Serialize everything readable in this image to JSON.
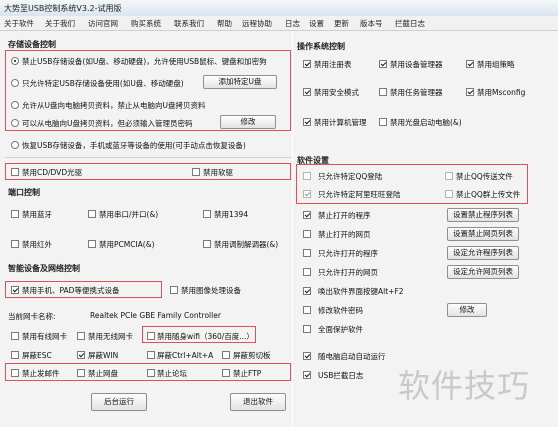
{
  "window": {
    "title": "大势至USB控制系统V3.2-试用版"
  },
  "menu": [
    "关于软件",
    "关于我们",
    "访问官网",
    "购买系统",
    "联系我们",
    "帮助",
    "远程协助",
    "日志",
    "设置",
    "更新",
    "版本号",
    "拦截日志"
  ],
  "storage": {
    "title": "存储设备控制",
    "options": [
      {
        "label": "禁止USB存储设备(如U盘、移动硬盘)，允许使用USB鼠标、键盘和加密狗",
        "selected": true
      },
      {
        "label": "只允许特定USB存储设备使用(如U盘、移动硬盘)",
        "selected": false
      },
      {
        "label": "允许从U盘向电脑拷贝资料，禁止从电脑向U盘拷贝资料",
        "selected": false
      },
      {
        "label": "可以从电脑向U盘拷贝资料，但必须输入管理员密码",
        "selected": false
      },
      {
        "label": "恢复USB存储设备，手机或蓝牙等设备的使用(可手动点击恢复设备)",
        "selected": false
      }
    ],
    "add_button": "添加特定U盘",
    "modify_button": "修改"
  },
  "media": {
    "cdrom": "禁用CD/DVD光驱",
    "floppy": "禁用软驱"
  },
  "ports": {
    "title": "端口控制",
    "items": [
      "禁用蓝牙",
      "禁用串口/并口(&)",
      "禁用1394",
      "禁用红外",
      "禁用PCMCIA(&)",
      "禁用调制解调器(&)"
    ]
  },
  "smart": {
    "title": "智能设备及网络控制",
    "phone": "禁用手机、PAD等便携式设备",
    "image": "禁用图像处理设备"
  },
  "nic": {
    "label": "当前网卡名称:",
    "value": "Realtek PCIe GBE Family Controller"
  },
  "net_items": [
    {
      "label": "禁用有线网卡",
      "checked": false
    },
    {
      "label": "禁用无线网卡",
      "checked": false
    },
    {
      "label": "禁用随身wifi（360/百度...）",
      "checked": false
    },
    {
      "label": "屏蔽ESC",
      "checked": false
    },
    {
      "label": "屏蔽WIN",
      "checked": true
    },
    {
      "label": "屏蔽Ctrl+Alt+A",
      "checked": false
    },
    {
      "label": "屏蔽剪切板",
      "checked": false
    },
    {
      "label": "禁止发邮件",
      "checked": false
    },
    {
      "label": "禁止网盘",
      "checked": false
    },
    {
      "label": "禁止论坛",
      "checked": false
    },
    {
      "label": "禁止FTP",
      "checked": false
    }
  ],
  "bottom": {
    "background_run": "后台运行",
    "exit": "退出软件"
  },
  "os": {
    "title": "操作系统控制",
    "items": [
      {
        "label": "禁用注册表",
        "checked": true
      },
      {
        "label": "禁用设备管理器",
        "checked": true
      },
      {
        "label": "禁用组策略",
        "checked": true
      },
      {
        "label": "禁用安全模式",
        "checked": true
      },
      {
        "label": "禁用任务管理器",
        "checked": false
      },
      {
        "label": "禁用Msconfig",
        "checked": true
      },
      {
        "label": "禁用计算机管理",
        "checked": true
      },
      {
        "label": "禁用光盘启动电脑(&)",
        "checked": false
      }
    ]
  },
  "software": {
    "title": "软件设置",
    "qq": [
      {
        "label": "只允许特定QQ登陆",
        "checked": false
      },
      {
        "label": "禁止QQ传送文件",
        "checked": false
      },
      {
        "label": "只允许特定阿里旺旺登陆",
        "checked": true
      },
      {
        "label": "禁止QQ群上传文件",
        "checked": false
      }
    ],
    "rows": [
      {
        "label": "禁止打开的程序",
        "checked": true,
        "button": "设置禁止程序列表"
      },
      {
        "label": "禁止打开的网页",
        "checked": false,
        "button": "设置禁止网页列表"
      },
      {
        "label": "只允许打开的程序",
        "checked": false,
        "button": "设定允许程序列表"
      },
      {
        "label": "只允许打开的网页",
        "checked": false,
        "button": "设定允许网页列表"
      },
      {
        "label": "唤出软件界面按键Alt+F2",
        "checked": true,
        "button": ""
      },
      {
        "label": "修改软件密码",
        "checked": false,
        "button": "修改"
      },
      {
        "label": "全面保护软件",
        "checked": false,
        "button": ""
      },
      {
        "label": "随电脑启动自动运行",
        "checked": true,
        "button": ""
      },
      {
        "label": "USB拦截日志",
        "checked": true,
        "button": ""
      }
    ]
  },
  "watermark": "软件技巧"
}
